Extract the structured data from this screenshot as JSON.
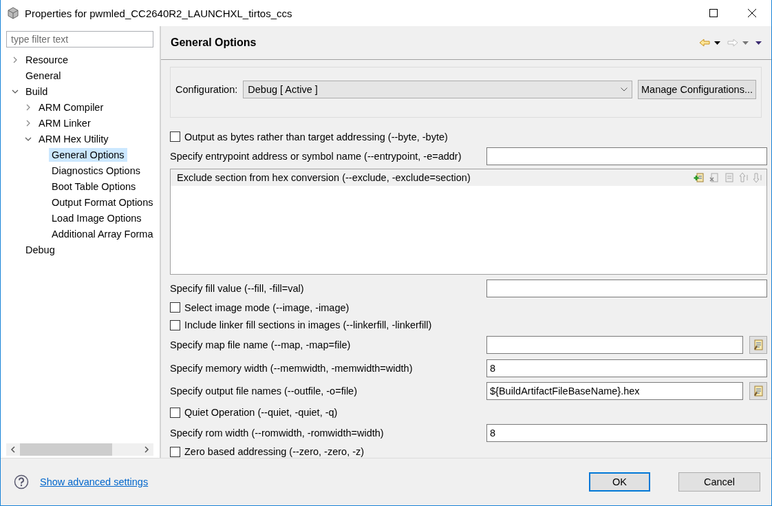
{
  "window": {
    "title": "Properties for pwmled_CC2640R2_LAUNCHXL_tirtos_ccs"
  },
  "sidebar": {
    "filter": {
      "placeholder": "type filter text"
    },
    "tree": [
      {
        "label": "Resource",
        "expanded": false,
        "has_children": true,
        "selected": false
      },
      {
        "label": "General",
        "selected": false
      },
      {
        "label": "Build",
        "expanded": true,
        "has_children": true,
        "selected": false,
        "children": [
          {
            "label": "ARM Compiler",
            "expanded": false,
            "has_children": true,
            "selected": false
          },
          {
            "label": "ARM Linker",
            "expanded": false,
            "has_children": true,
            "selected": false
          },
          {
            "label": "ARM Hex Utility",
            "expanded": true,
            "has_children": true,
            "selected": false,
            "children": [
              {
                "label": "General Options",
                "selected": true
              },
              {
                "label": "Diagnostics Options",
                "selected": false
              },
              {
                "label": "Boot Table Options",
                "selected": false
              },
              {
                "label": "Output Format Options",
                "selected": false
              },
              {
                "label": "Load Image Options",
                "selected": false
              },
              {
                "label": "Additional Array Forma",
                "selected": false
              }
            ]
          }
        ]
      },
      {
        "label": "Debug",
        "selected": false
      }
    ]
  },
  "page": {
    "title": "General Options",
    "configuration": {
      "label": "Configuration:",
      "value": "Debug  [ Active ]",
      "button": "Manage Configurations..."
    },
    "options": [
      {
        "kind": "checkbox",
        "label": "Output as bytes rather than target addressing (--byte, -byte)",
        "checked": false
      },
      {
        "kind": "text",
        "label": "Specify entrypoint address or symbol name (--entrypoint, -e=addr)"
      },
      {
        "kind": "list",
        "label": "Exclude section from hex conversion (--exclude, -exclude=section)"
      },
      {
        "kind": "text",
        "label": "Specify fill value (--fill, -fill=val)"
      },
      {
        "kind": "checkbox",
        "label": "Select image mode (--image, -image)",
        "checked": false
      },
      {
        "kind": "checkbox",
        "label": "Include linker fill sections in images (--linkerfill, -linkerfill)",
        "checked": false
      },
      {
        "kind": "browse",
        "label": "Specify map file name (--map, -map=file)"
      },
      {
        "kind": "text",
        "label": "Specify memory width (--memwidth, -memwidth=width)",
        "value": "8"
      },
      {
        "kind": "browse",
        "label": "Specify output file names (--outfile, -o=file)",
        "value": "${BuildArtifactFileBaseName}.hex"
      },
      {
        "kind": "checkbox",
        "label": "Quiet Operation (--quiet, -quiet, -q)",
        "checked": false
      },
      {
        "kind": "text",
        "label": "Specify rom width (--romwidth, -romwidth=width)",
        "value": "8"
      },
      {
        "kind": "checkbox",
        "label": "Zero based addressing (--zero, -zero, -z)",
        "checked": false
      }
    ]
  },
  "footer": {
    "link": "Show advanced settings",
    "buttons": [
      {
        "label": "OK",
        "default": true
      },
      {
        "label": "Cancel",
        "default": false
      }
    ]
  }
}
